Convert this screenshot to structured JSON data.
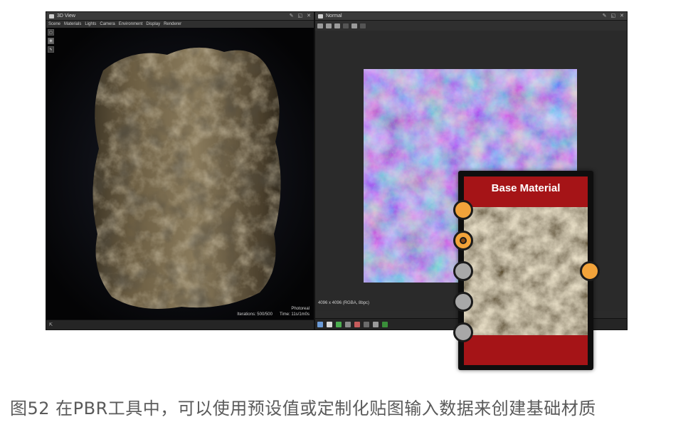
{
  "left_panel": {
    "title": "3D View",
    "menu": [
      "Scene",
      "Materials",
      "Lights",
      "Camera",
      "Environment",
      "Display",
      "Renderer"
    ],
    "render_mode": "Photoreal",
    "iterations": "Iterations: 500/500",
    "time": "Time: 11s/1m0s"
  },
  "right_panel": {
    "title": "Normal",
    "image_info": "4096 x 4096 (RGBA, 8bpc)"
  },
  "node": {
    "title": "Base Material",
    "accent_color": "#a51417",
    "pin_color": "#f2a33a"
  },
  "caption": "图52 在PBR工具中，可以使用预设值或定制化贴图输入数据来创建基础材质"
}
